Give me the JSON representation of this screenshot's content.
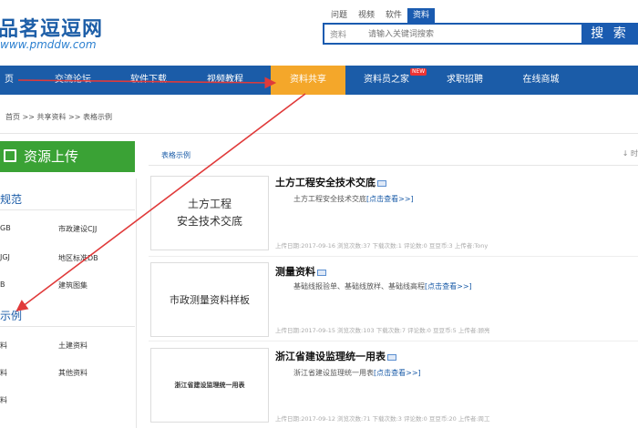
{
  "header": {
    "logo_text": "品茗逗逗网",
    "logo_url": "www.pmddw.com",
    "search_tabs": [
      "问题",
      "视频",
      "软件",
      "资料"
    ],
    "search_category": "资料",
    "search_placeholder": "请输入关键词搜索",
    "search_button": "搜 索"
  },
  "nav": {
    "items": [
      "页",
      "交流论坛",
      "软件下载",
      "视频教程",
      "资料共享",
      "资料员之家",
      "求职招聘",
      "在线商城"
    ],
    "active": "资料共享",
    "badge": "NEW"
  },
  "breadcrumb": "首页 >> 共享资料 >> 表格示例",
  "sidebar": {
    "upload_label": "资源上传",
    "section1_head": "规范",
    "section1_links": [
      "GB",
      "市政建设CJJ",
      "JGJ",
      "地区标准DB",
      "B",
      "建筑图集"
    ],
    "section2_head": "示例",
    "section2_links": [
      "料",
      "土建资料",
      "料",
      "其他资料",
      "料"
    ]
  },
  "main": {
    "tab_label": "表格示例",
    "right_text": "↓ 时",
    "items": [
      {
        "thumb": "土方工程\n安全技术交底",
        "title": "土方工程安全技术交底",
        "desc": "土方工程安全技术交底",
        "more": "[点击查看>>]",
        "meta": "上传日期:2017-09-16  浏览次数:37  下载次数:1  评论数:0  豆豆币:3  上传者:Tony"
      },
      {
        "thumb": "市政测量资料样板",
        "title": "测量资料",
        "desc": "基础线报验单、基础线放样、基础线高程",
        "more": "[点击查看>>]",
        "meta": "上传日期:2017-09-15  浏览次数:103  下载次数:7  评论数:0  豆豆币:5  上传者:顾亮"
      },
      {
        "thumb": "浙江省建设监理统一用表",
        "title": "浙江省建设监理统一用表",
        "desc": "浙江省建设监理统一用表",
        "more": "[点击查看>>]",
        "meta": "上传日期:2017-09-12  浏览次数:71  下载次数:3  评论数:0  豆豆币:20  上传者:周工"
      }
    ]
  },
  "colors": {
    "brand_blue": "#1b5ca8",
    "active_orange": "#f4a72a",
    "upload_green": "#3aa235",
    "annotation_red": "#e03a3a"
  }
}
